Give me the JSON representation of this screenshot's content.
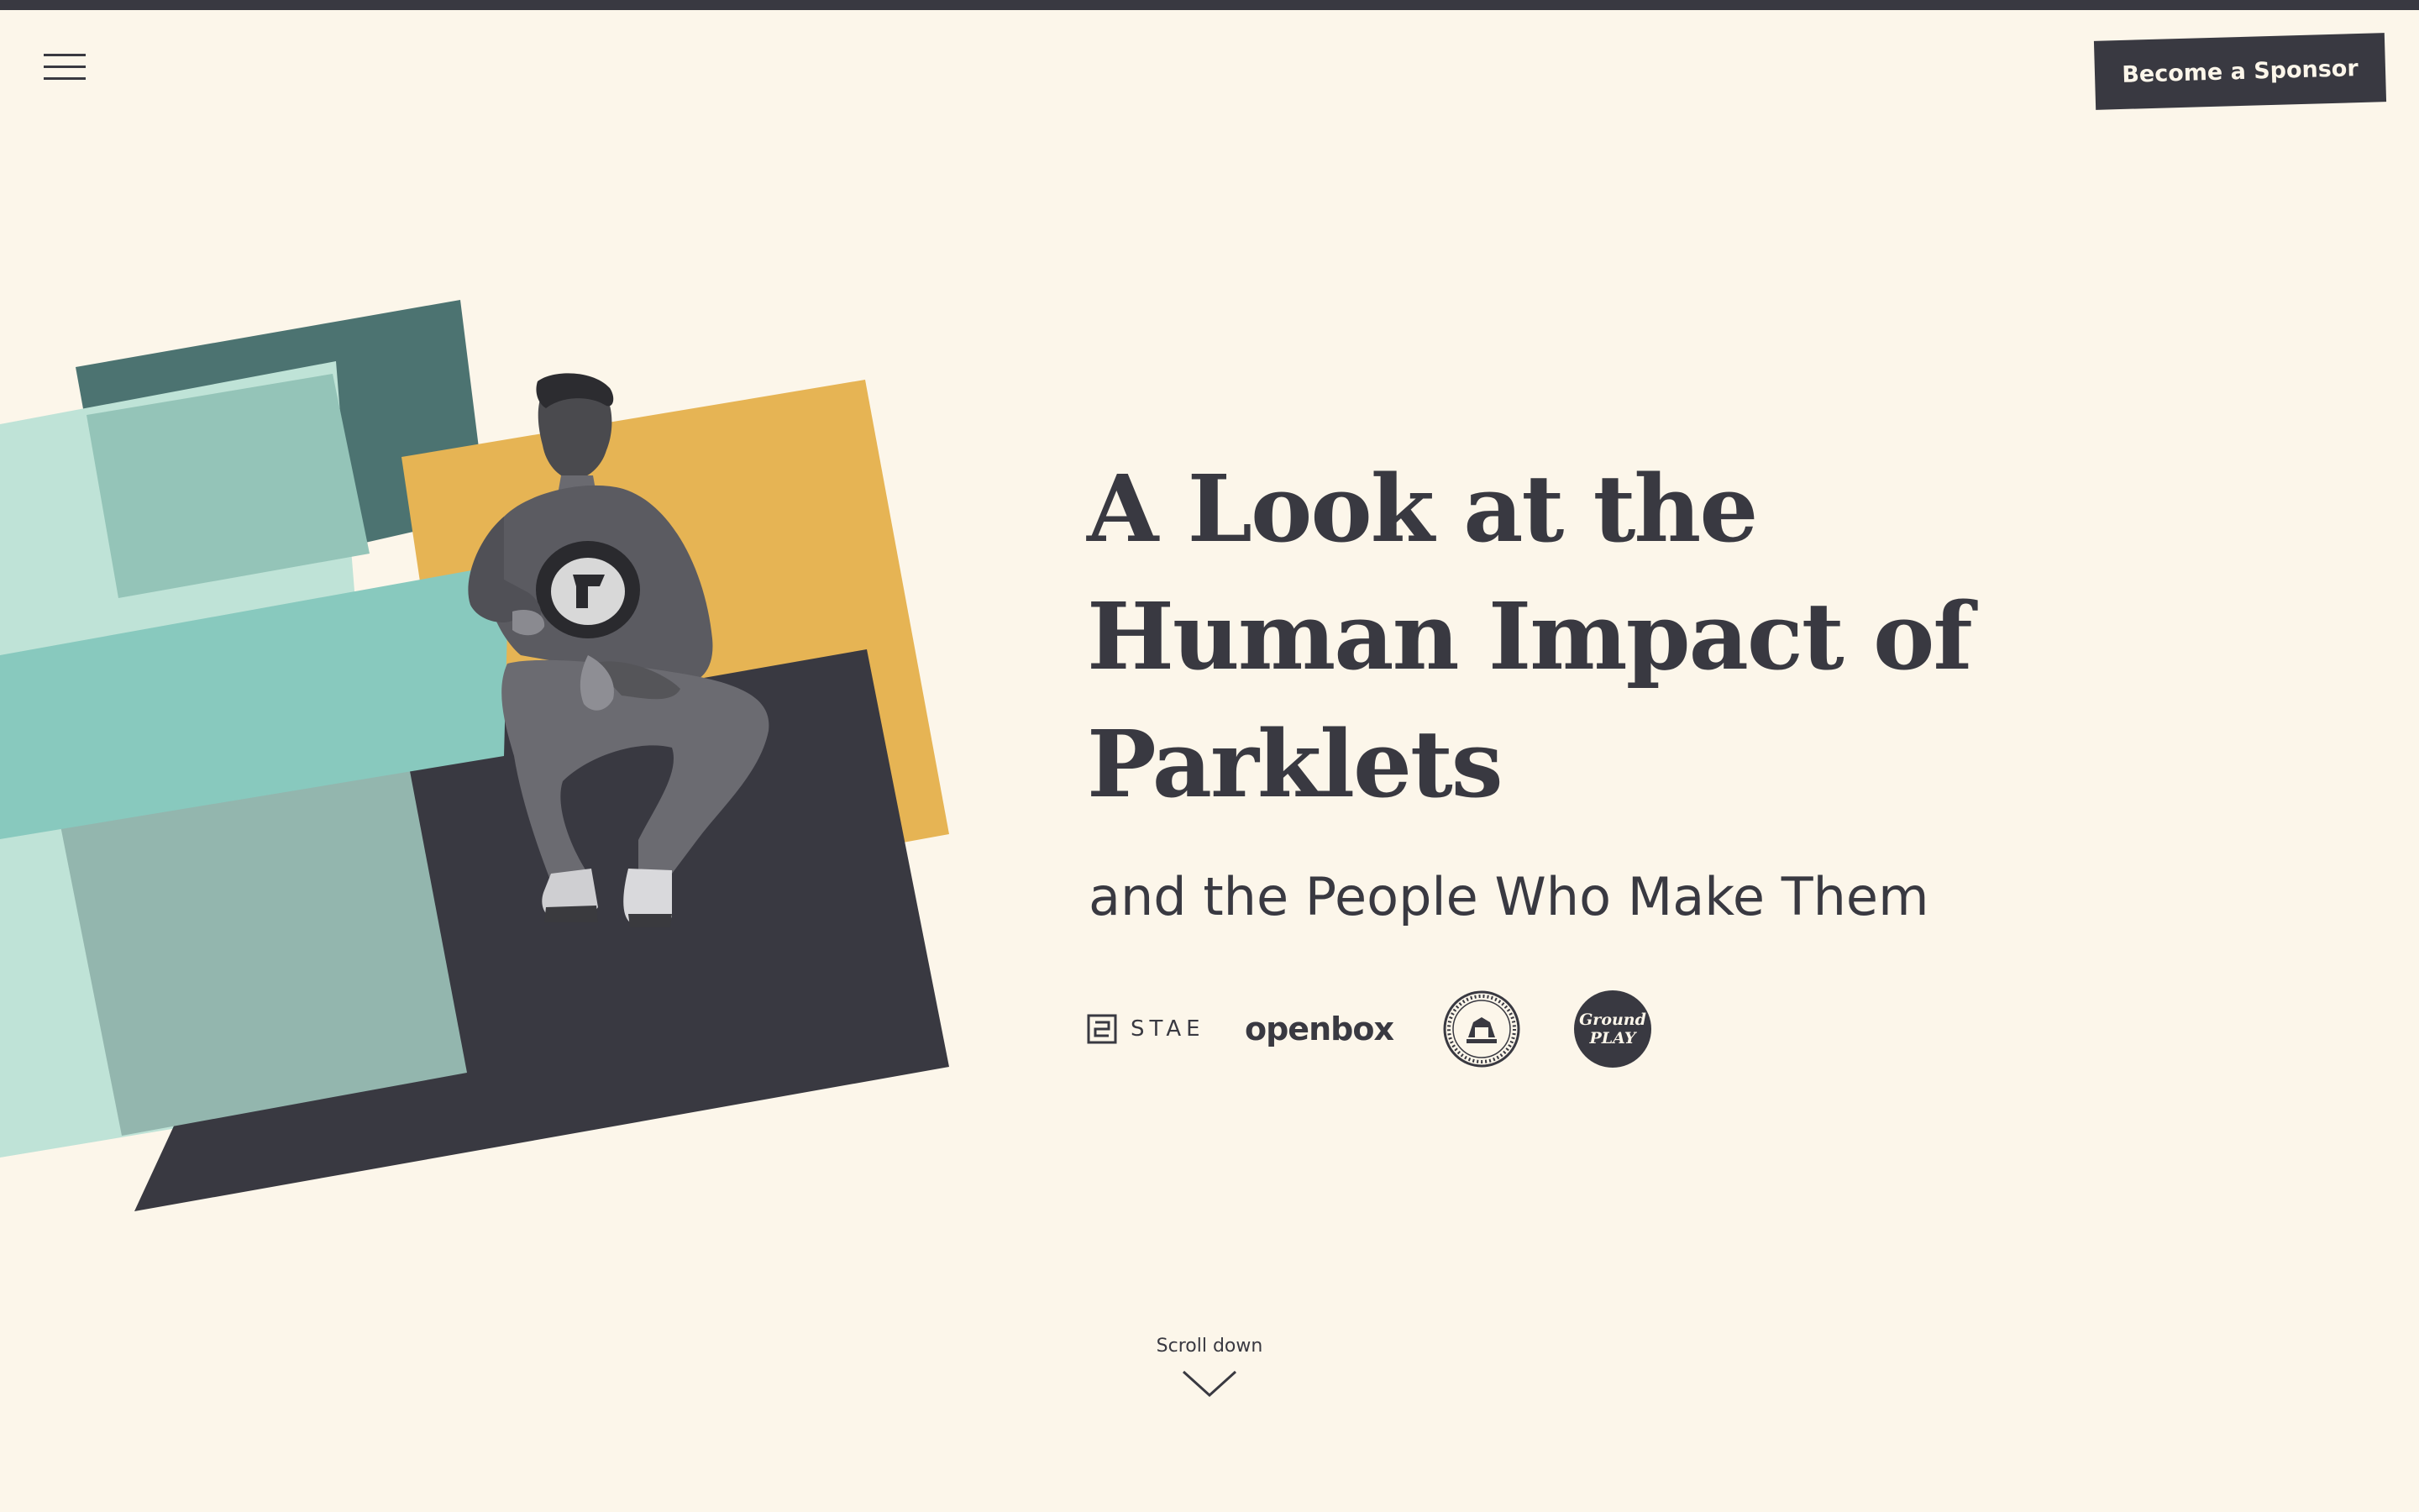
{
  "header": {
    "menu_icon": "hamburger-menu-icon",
    "sponsor_button": "Become a Sponsor"
  },
  "hero": {
    "title_lines": [
      "A Look at the",
      "Human Impact of",
      "Parklets"
    ],
    "subtitle": "and the People Who Make Them",
    "image_icon": "man-sitting-photo",
    "colors": {
      "dark_teal": "#4c7371",
      "light_mint": "#bfe3d7",
      "mid_teal": "#94c4b8",
      "turquoise": "#88c9be",
      "sage": "#93b6ae",
      "gold": "#e6b454",
      "charcoal": "#393941",
      "background": "#fcf6ea"
    }
  },
  "partners": [
    {
      "name": "STAE",
      "icon": "stae-logo-icon"
    },
    {
      "name": "openbox",
      "icon": "openbox-logo-icon"
    },
    {
      "name": "City and County of San Francisco seal",
      "icon": "sf-city-seal-icon"
    },
    {
      "name": "Ground Play",
      "line1": "Ground",
      "line2": "PLAY",
      "icon": "groundplay-logo-icon"
    }
  ],
  "scroll": {
    "label": "Scroll down",
    "icon": "chevron-down-icon"
  }
}
